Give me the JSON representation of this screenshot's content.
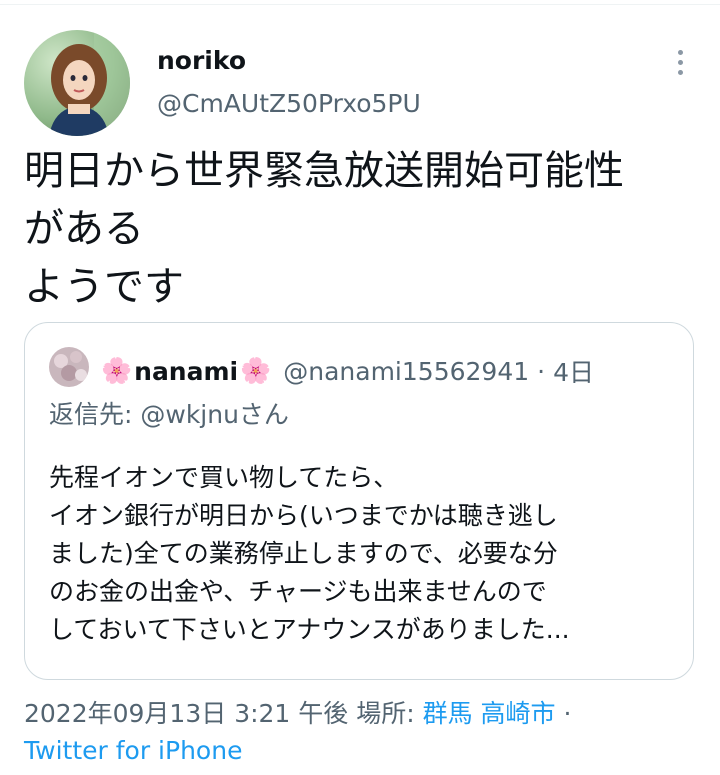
{
  "tweet": {
    "author_name": "noriko",
    "author_handle": "@CmAUtZ50Prxo5PU",
    "text_lines": [
      "明日から世界緊急放送開始可能性",
      "がある",
      "ようです"
    ]
  },
  "quote": {
    "flower_emoji": "🌸",
    "name": "nanami",
    "handle": "@nanami15562941",
    "separator": "·",
    "time": "4日",
    "reply_to": "返信先: @wkjnuさん",
    "body_lines": [
      "先程イオンで買い物してたら、",
      "イオン銀行が明日から(いつまでかは聴き逃し",
      "ました)全ての業務停止しますので、必要な分",
      "のお金の出金や、チャージも出来ませんので",
      "しておいて下さいとアナウンスがありました..."
    ]
  },
  "meta": {
    "datetime": "2022年09月13日 3:21 午後",
    "location_label": " 場所: ",
    "location": "群馬 高崎市",
    "separator": " ·",
    "source": "Twitter for iPhone"
  },
  "icons": {
    "more": "more-vertical-icon",
    "flower": "cherry-blossom-icon"
  },
  "colors": {
    "text": "#0f1419",
    "secondary": "#536471",
    "link": "#1d9bf0",
    "border": "#cfd9de"
  }
}
